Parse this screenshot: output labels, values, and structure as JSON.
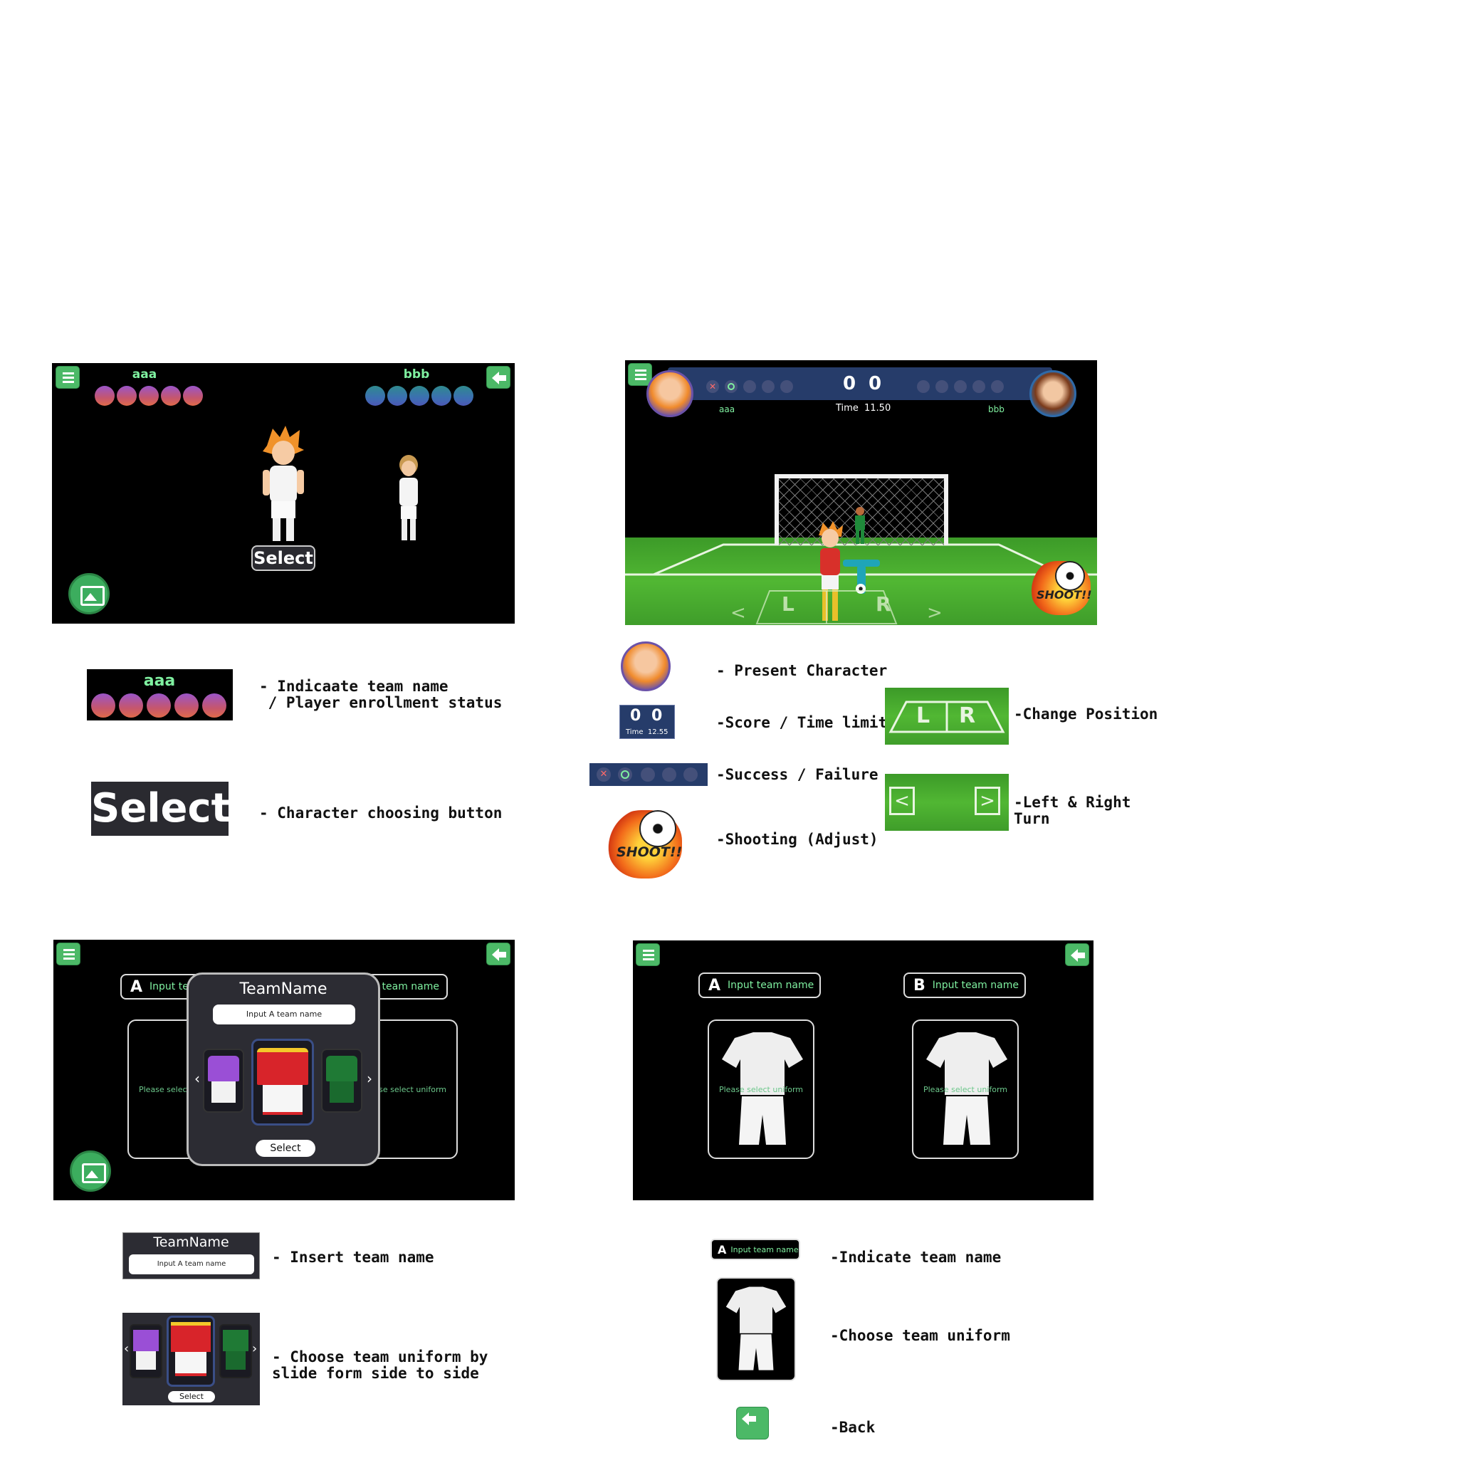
{
  "screen1": {
    "team_a": "aaa",
    "team_b": "bbb",
    "select_label": "Select"
  },
  "screen2": {
    "score_a": "0",
    "score_b": "0",
    "time_label": "Time",
    "time_value": "11.50",
    "team_a": "aaa",
    "team_b": "bbb",
    "shoot_label": "SHOOT!!",
    "left_label": "L",
    "right_label": "R"
  },
  "screen3": {
    "modal_title": "TeamName",
    "input_placeholder": "Input A team name",
    "select_label": "Select",
    "team_a_letter": "A",
    "team_a_placeholder": "Input team name",
    "team_b_placeholder": "team name",
    "uniform_hint": "Please select uniform"
  },
  "screen4": {
    "team_a_letter": "A",
    "team_b_letter": "B",
    "team_name_placeholder": "Input team name",
    "uniform_hint": "Please select uniform"
  },
  "legend": {
    "team_status_name": "aaa",
    "team_status_label": "- Indicaate team name\n / Player enrollment status",
    "select_button": "Select",
    "select_desc": "- Character choosing button",
    "present_character": "- Present Character",
    "score_sample_a": "0",
    "score_sample_b": "0",
    "score_sample_time": "Time  12.55",
    "score_desc": "-Score / Time limit",
    "success_desc": "-Success / Failure",
    "shoot_sample": "SHOOT!!",
    "shooting_desc": "-Shooting (Adjust)",
    "change_position_desc": "-Change Position",
    "left_right_desc": "-Left & Right\nTurn",
    "teamname_title": "TeamName",
    "teamname_placeholder": "Input A team name",
    "insert_desc": "- Insert team name",
    "uniform_select": "Select",
    "uniform_slide_desc": "- Choose team uniform by\nslide form side to side",
    "indicate_letter": "A",
    "indicate_placeholder": "Input team name",
    "indicate_desc": "-Indicate team name",
    "choose_desc": "-Choose team uniform",
    "back_desc": "-Back"
  },
  "colors": {
    "accent_green": "#4cb967",
    "team_text": "#7ff0a0",
    "score_panel": "#263c6a"
  }
}
